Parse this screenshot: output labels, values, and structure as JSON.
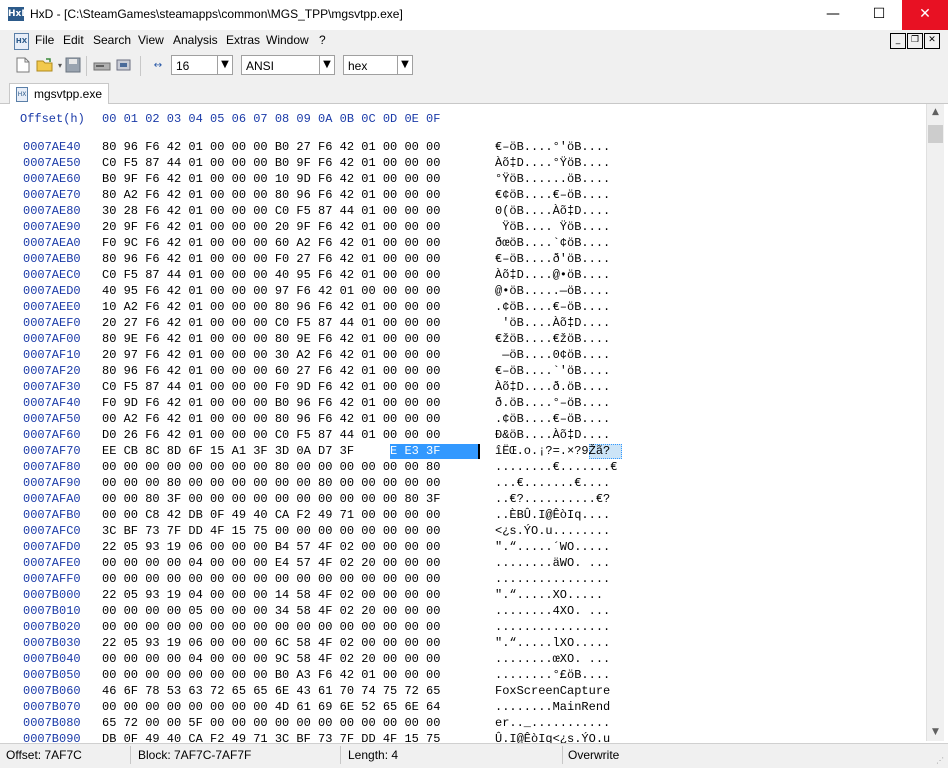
{
  "window": {
    "app_icon_text": "HxD",
    "title": "HxD - [C:\\SteamGames\\steamapps\\common\\MGS_TPP\\mgsvtpp.exe]",
    "minimize": "—",
    "maximize": "☐",
    "close": "✕"
  },
  "menu": {
    "items": [
      "File",
      "Edit",
      "Search",
      "View",
      "Analysis",
      "Extras",
      "Window",
      "?"
    ],
    "mdi_minimize": "_",
    "mdi_restore": "❐",
    "mdi_close": "✕"
  },
  "toolbar": {
    "bytes_per_row": "16",
    "charset": "ANSI",
    "offset_base": "hex",
    "icons": [
      "new-file-icon",
      "open-folder-icon",
      "save-icon",
      "open-disk-icon",
      "open-ram-icon",
      "bytes-per-row-icon"
    ]
  },
  "tab": {
    "label": "mgsvtpp.exe"
  },
  "editor": {
    "header_label": "Offset(h)",
    "columns": [
      "00",
      "01",
      "02",
      "03",
      "04",
      "05",
      "06",
      "07",
      "08",
      "09",
      "0A",
      "0B",
      "0C",
      "0D",
      "0E",
      "0F"
    ],
    "rows": [
      {
        "off": "0007AE40",
        "hex": "80 96 F6 42 01 00 00 00 B0 27 F6 42 01 00 00 00",
        "asc": "€–öB....°'öB...."
      },
      {
        "off": "0007AE50",
        "hex": "C0 F5 87 44 01 00 00 00 B0 9F F6 42 01 00 00 00",
        "asc": "Àõ‡D....°ŸöB...."
      },
      {
        "off": "0007AE60",
        "hex": "B0 9F F6 42 01 00 00 00 10 9D F6 42 01 00 00 00",
        "asc": "°ŸöB......öB...."
      },
      {
        "off": "0007AE70",
        "hex": "80 A2 F6 42 01 00 00 00 80 96 F6 42 01 00 00 00",
        "asc": "€¢öB....€–öB...."
      },
      {
        "off": "0007AE80",
        "hex": "30 28 F6 42 01 00 00 00 C0 F5 87 44 01 00 00 00",
        "asc": "0(öB....Àõ‡D...."
      },
      {
        "off": "0007AE90",
        "hex": "20 9F F6 42 01 00 00 00 20 9F F6 42 01 00 00 00",
        "asc": " ŸöB.... ŸöB...."
      },
      {
        "off": "0007AEA0",
        "hex": "F0 9C F6 42 01 00 00 00 60 A2 F6 42 01 00 00 00",
        "asc": "ðœöB....`¢öB...."
      },
      {
        "off": "0007AEB0",
        "hex": "80 96 F6 42 01 00 00 00 F0 27 F6 42 01 00 00 00",
        "asc": "€–öB....ð'öB...."
      },
      {
        "off": "0007AEC0",
        "hex": "C0 F5 87 44 01 00 00 00 40 95 F6 42 01 00 00 00",
        "asc": "Àõ‡D....@•öB...."
      },
      {
        "off": "0007AED0",
        "hex": "40 95 F6 42 01 00 00 00 97 F6 42 01 00 00 00 00",
        "asc": "@•öB.....—öB...."
      },
      {
        "off": "0007AEE0",
        "hex": "10 A2 F6 42 01 00 00 00 80 96 F6 42 01 00 00 00",
        "asc": ".¢öB....€–öB...."
      },
      {
        "off": "0007AEF0",
        "hex": "20 27 F6 42 01 00 00 00 C0 F5 87 44 01 00 00 00",
        "asc": " 'öB....Àõ‡D...."
      },
      {
        "off": "0007AF00",
        "hex": "80 9E F6 42 01 00 00 00 80 9E F6 42 01 00 00 00",
        "asc": "€žöB....€žöB...."
      },
      {
        "off": "0007AF10",
        "hex": "20 97 F6 42 01 00 00 00 30 A2 F6 42 01 00 00 00",
        "asc": " —öB....0¢öB...."
      },
      {
        "off": "0007AF20",
        "hex": "80 96 F6 42 01 00 00 00 60 27 F6 42 01 00 00 00",
        "asc": "€–öB....`'öB...."
      },
      {
        "off": "0007AF30",
        "hex": "C0 F5 87 44 01 00 00 00 F0 9D F6 42 01 00 00 00",
        "asc": "Àõ‡D....ð.öB...."
      },
      {
        "off": "0007AF40",
        "hex": "F0 9D F6 42 01 00 00 00 B0 96 F6 42 01 00 00 00",
        "asc": "ð.öB....°–öB...."
      },
      {
        "off": "0007AF50",
        "hex": "00 A2 F6 42 01 00 00 00 80 96 F6 42 01 00 00 00",
        "asc": ".¢öB....€–öB...."
      },
      {
        "off": "0007AF60",
        "hex": "D0 26 F6 42 01 00 00 00 C0 F5 87 44 01 00 00 00",
        "asc": "Ð&öB....Àõ‡D...."
      },
      {
        "off": "0007AF70",
        "hex": "EE CB 8C 8D 6F 15 A1 3F 3D 0A D7 3F 39 8E E3 3F",
        "asc": "îËŒ.o.¡?=.×?9Žã?"
      },
      {
        "off": "0007AF80",
        "hex": "00 00 00 00 00 00 00 00 80 00 00 00 00 00 00 80",
        "asc": "........€.......€"
      },
      {
        "off": "0007AF90",
        "hex": "00 00 00 80 00 00 00 00 00 00 80 00 00 00 00 00",
        "asc": "...€.......€...."
      },
      {
        "off": "0007AFA0",
        "hex": "00 00 80 3F 00 00 00 00 00 00 00 00 00 00 80 3F",
        "asc": "..€?..........€?"
      },
      {
        "off": "0007AFB0",
        "hex": "00 00 C8 42 DB 0F 49 40 CA F2 49 71 00 00 00 00",
        "asc": "..ÈBÛ.I@ÊòIq...."
      },
      {
        "off": "0007AFC0",
        "hex": "3C BF 73 7F DD 4F 15 75 00 00 00 00 00 00 00 00",
        "asc": "<¿s.ÝO.u........"
      },
      {
        "off": "0007AFD0",
        "hex": "22 05 93 19 06 00 00 00 B4 57 4F 02 00 00 00 00",
        "asc": "\".“.....´WO....."
      },
      {
        "off": "0007AFE0",
        "hex": "00 00 00 00 04 00 00 00 E4 57 4F 02 20 00 00 00",
        "asc": "........äWO. ..."
      },
      {
        "off": "0007AFF0",
        "hex": "00 00 00 00 00 00 00 00 00 00 00 00 00 00 00 00",
        "asc": "................"
      },
      {
        "off": "0007B000",
        "hex": "22 05 93 19 04 00 00 00 14 58 4F 02 00 00 00 00",
        "asc": "\".“.....XO....."
      },
      {
        "off": "0007B010",
        "hex": "00 00 00 00 05 00 00 00 34 58 4F 02 20 00 00 00",
        "asc": "........4XO. ..."
      },
      {
        "off": "0007B020",
        "hex": "00 00 00 00 00 00 00 00 00 00 00 00 00 00 00 00",
        "asc": "................"
      },
      {
        "off": "0007B030",
        "hex": "22 05 93 19 06 00 00 00 6C 58 4F 02 00 00 00 00",
        "asc": "\".“.....lXO....."
      },
      {
        "off": "0007B040",
        "hex": "00 00 00 00 04 00 00 00 9C 58 4F 02 20 00 00 00",
        "asc": "........œXO. ..."
      },
      {
        "off": "0007B050",
        "hex": "00 00 00 00 00 00 00 00 B0 A3 F6 42 01 00 00 00",
        "asc": "........°£öB...."
      },
      {
        "off": "0007B060",
        "hex": "46 6F 78 53 63 72 65 65 6E 43 61 70 74 75 72 65",
        "asc": "FoxScreenCapture"
      },
      {
        "off": "0007B070",
        "hex": "00 00 00 00 00 00 00 00 4D 61 69 6E 52 65 6E 64",
        "asc": "........MainRend"
      },
      {
        "off": "0007B080",
        "hex": "65 72 00 00 5F 00 00 00 00 00 00 00 00 00 00 00",
        "asc": "er.._..........."
      },
      {
        "off": "0007B090",
        "hex": "DB 0F 49 40 CA F2 49 71 3C BF 73 7F DD 4F 15 75",
        "asc": "Û.I@ÊòIq<¿s.ÝO.u"
      }
    ]
  },
  "status": {
    "offset": "Offset: 7AF7C",
    "block": "Block: 7AF7C-7AF7F",
    "length": "Length: 4",
    "mode": "Overwrite"
  },
  "colors": {
    "offset_blue": "#1a3aa8",
    "selection": "#3399ff",
    "close_red": "#e81123"
  }
}
